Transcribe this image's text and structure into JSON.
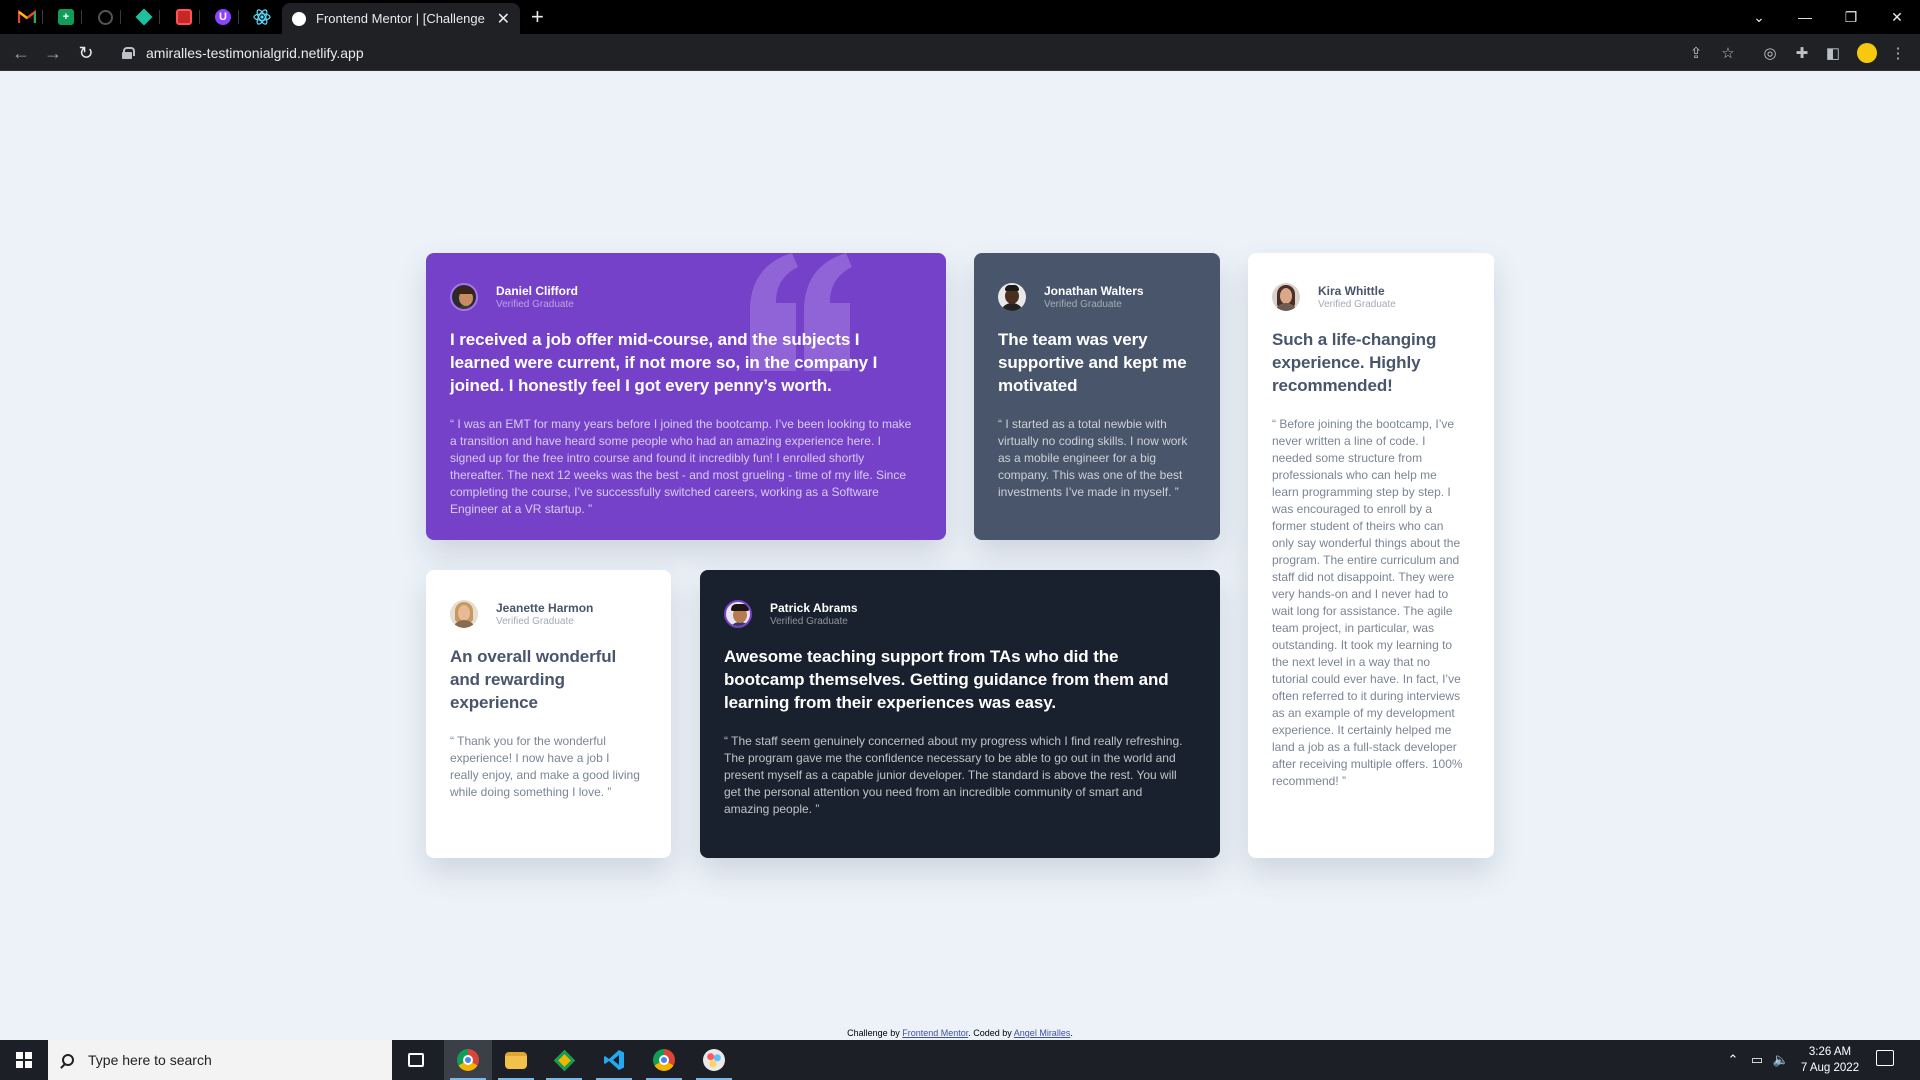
{
  "browser": {
    "active_tab_title": "Frontend Mentor | [Challenge Na",
    "url": "amiralles-testimonialgrid.netlify.app",
    "pinned_tabs": [
      "gmail",
      "sheets",
      "github",
      "app-green",
      "app-red",
      "app-purple",
      "react"
    ]
  },
  "testimonials": [
    {
      "name": "Daniel Clifford",
      "role": "Verified Graduate",
      "headline": "I received a job offer mid-course, and the subjects I learned were current, if not more so, in the company I joined. I honestly feel I got every penny’s worth.",
      "quote": "“ I was an EMT for many years before I joined the bootcamp. I’ve been looking to make a transition and have heard some people who had an amazing experience here. I signed up for the free intro course and found it incredibly fun! I enrolled shortly thereafter. The next 12 weeks was the best - and most grueling - time of my life. Since completing the course, I’ve successfully switched careers, working as a Software Engineer at a VR startup. ”"
    },
    {
      "name": "Jonathan Walters",
      "role": "Verified Graduate",
      "headline": "The team was very supportive and kept me motivated",
      "quote": "“ I started as a total newbie with virtually no coding skills. I now work as a mobile engineer for a big company. This was one of the best investments I’ve made in myself. ”"
    },
    {
      "name": "Kira Whittle",
      "role": "Verified Graduate",
      "headline": "Such a life-changing experience. Highly recommended!",
      "quote": "“ Before joining the bootcamp, I’ve never written a line of code. I needed some structure from professionals who can help me learn programming step by step. I was encouraged to enroll by a former student of theirs who can only say wonderful things about the program. The entire curriculum and staff did not disappoint. They were very hands-on and I never had to wait long for assistance. The agile team project, in particular, was outstanding. It took my learning to the next level in a way that no tutorial could ever have. In fact, I’ve often referred to it during interviews as an example of my development experience. It certainly helped me land a job as a full-stack developer after receiving multiple offers. 100% recommend! ”"
    },
    {
      "name": "Jeanette Harmon",
      "role": "Verified Graduate",
      "headline": "An overall wonderful and rewarding experience",
      "quote": "“ Thank you for the wonderful experience! I now have a job I really enjoy, and make a good living while doing something I love. ”"
    },
    {
      "name": "Patrick Abrams",
      "role": "Verified Graduate",
      "headline": "Awesome teaching support from TAs who did the bootcamp themselves. Getting guidance from them and learning from their experiences was easy.",
      "quote": "“ The staff seem genuinely concerned about my progress which I find really refreshing. The program gave me the confidence necessary to be able to go out in the world and present myself as a capable junior developer. The standard is above the rest. You will get the personal attention you need from an incredible community of smart and amazing people. ”"
    }
  ],
  "attribution": {
    "prefix": "Challenge by ",
    "link1": "Frontend Mentor",
    "middle": ". Coded by ",
    "link2": "Angel Miralles",
    "suffix": "."
  },
  "taskbar": {
    "search_placeholder": "Type here to search",
    "time": "3:26 AM",
    "date": "7 Aug 2022"
  },
  "colors": {
    "page_bg": "#ECF2F8",
    "purple": "#7541C8",
    "slate": "#48556A",
    "dark": "#19212E",
    "white": "#FFFFFF"
  }
}
